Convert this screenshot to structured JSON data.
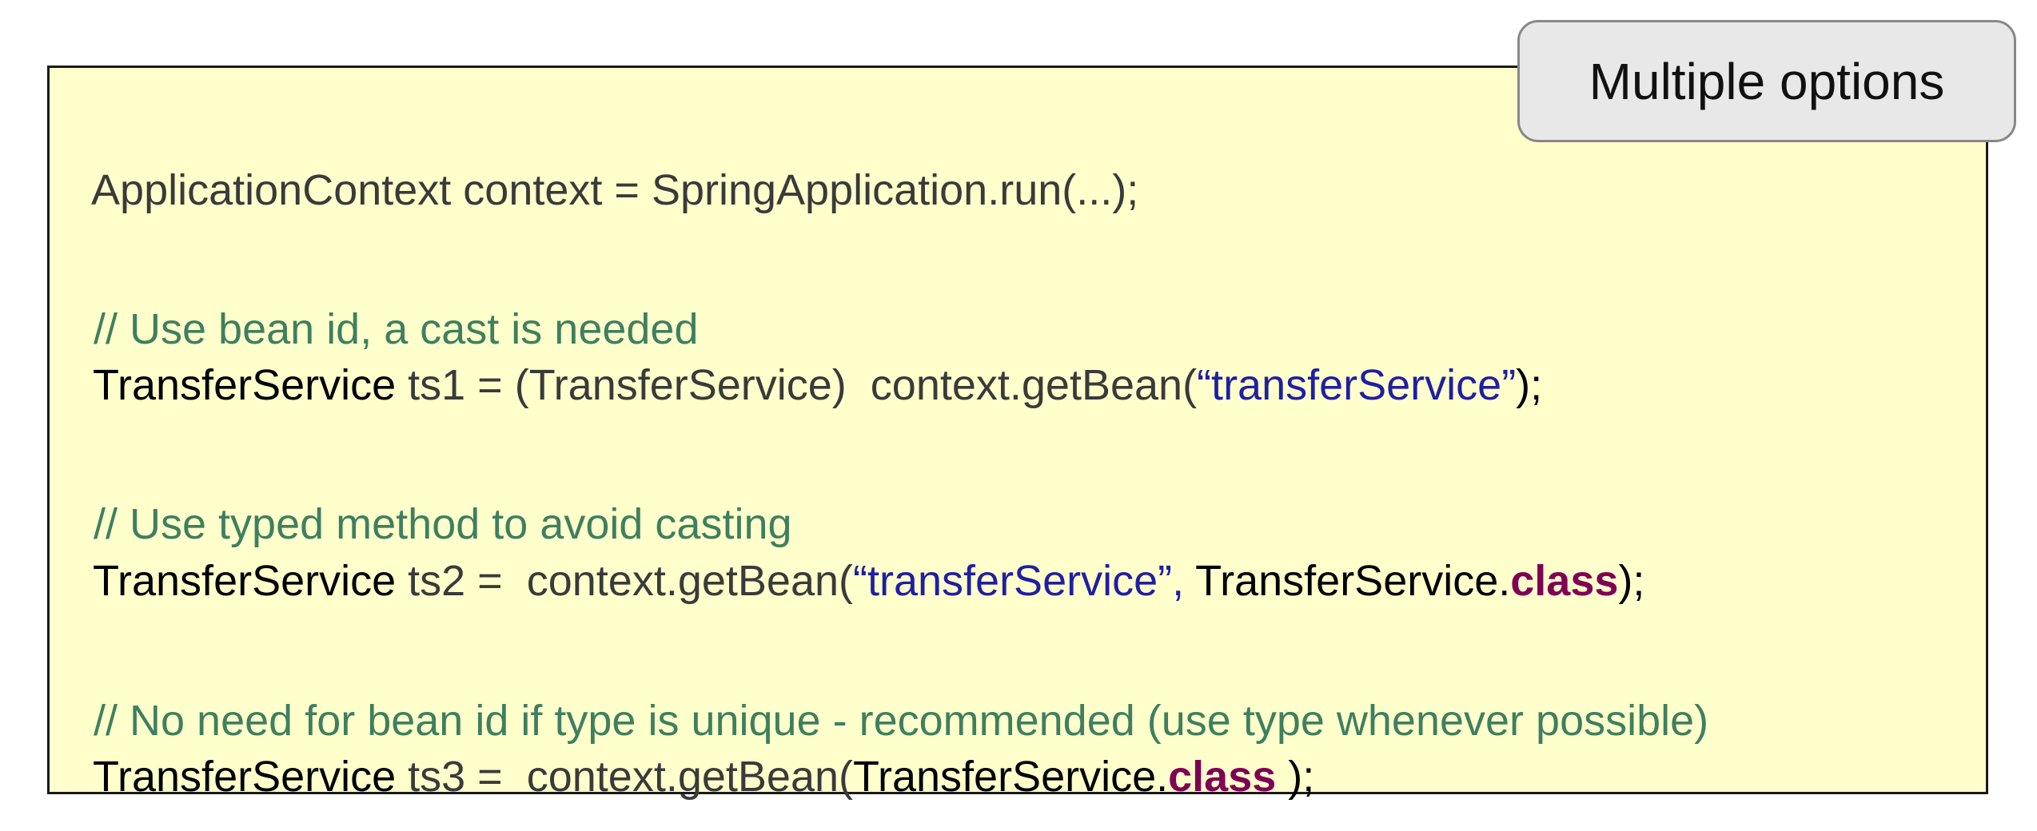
{
  "badge": {
    "label": "Multiple options"
  },
  "code": {
    "line1": {
      "text": "ApplicationContext context = SpringApplication.run(...);"
    },
    "comment1": "// Use bean id, a cast is needed",
    "line2": {
      "type": "TransferService",
      "rest": " ts1 = (TransferService)  context.getBean(",
      "string": "“transferService”",
      "end": ");"
    },
    "comment2": "// Use typed method to avoid casting",
    "line3": {
      "type": "TransferService",
      "rest": " ts2 =  context.getBean(",
      "string": "“transferService”,",
      "arg_type": " TransferService.",
      "keyword": "class",
      "end": ");"
    },
    "comment3": "// No need for bean id if type is unique - recommended (use type whenever possible)",
    "line4": {
      "type": "TransferService",
      "rest": " ts3 =  context.getBean(",
      "arg_type": "TransferService.",
      "keyword": "class",
      "end": " );"
    }
  },
  "colors": {
    "background": "#ffffcc",
    "comment": "#3f7f5f",
    "string": "#1f1fa3",
    "keyword": "#7f0055",
    "badge_bg": "#e8e8e8"
  }
}
